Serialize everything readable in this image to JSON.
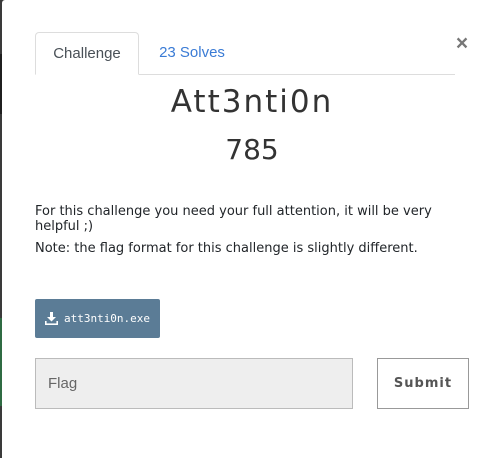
{
  "modal": {
    "close_label": "×",
    "tabs": [
      {
        "label": "Challenge"
      },
      {
        "label": "23 Solves"
      }
    ],
    "challenge": {
      "name": "Att3nti0n",
      "value": "785",
      "description": [
        "For this challenge you need your full attention, it will be very helpful ;)",
        "Note: the flag format for this challenge is slightly different."
      ],
      "file": {
        "label": "att3nti0n.exe",
        "icon": "download-icon"
      }
    },
    "form": {
      "flag_placeholder": "Flag",
      "flag_value": "",
      "submit_label": "Submit"
    }
  },
  "colors": {
    "tab_link": "#3a7bd5",
    "file_button": "#5b7c96",
    "input_bg": "#eeeeee"
  }
}
